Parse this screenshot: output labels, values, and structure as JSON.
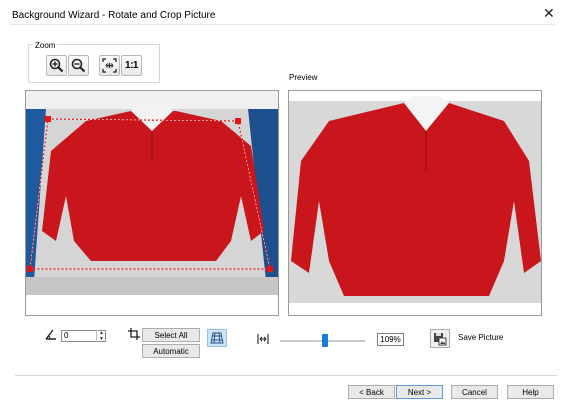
{
  "window": {
    "title": "Background Wizard - Rotate and Crop Picture",
    "close_glyph": "✕"
  },
  "zoom": {
    "label": "Zoom",
    "buttons": [
      {
        "name": "zoom-in",
        "icon": "zoom-in-icon"
      },
      {
        "name": "zoom-out",
        "icon": "zoom-out-icon"
      },
      {
        "name": "fit",
        "icon": "fit-to-window-icon"
      },
      {
        "name": "actual-size",
        "icon": "actual-size-icon",
        "label": "1:1"
      }
    ]
  },
  "preview": {
    "label": "Preview"
  },
  "rotate": {
    "icon": "rotate-angle-icon",
    "value": "0",
    "up": "▲",
    "down": "▼"
  },
  "crop": {
    "icon": "crop-icon",
    "select_all_label": "Select All",
    "automatic_label": "Automatic",
    "perspective_icon": "perspective-crop-icon"
  },
  "fit_width": {
    "icon": "fit-width-icon"
  },
  "zoom_slider": {
    "value_percent": 109,
    "display": "109%"
  },
  "save": {
    "icon": "save-picture-icon",
    "label": "Save Picture"
  },
  "nav": {
    "back_label": "< Back",
    "next_label": "Next >",
    "cancel_label": "Cancel",
    "help_label": "Help"
  },
  "colors": {
    "accent": "#1a7ad8",
    "shirt": "#c8161c",
    "crop_handle": "#ee1111",
    "background_blue": "#1e4f8f"
  }
}
